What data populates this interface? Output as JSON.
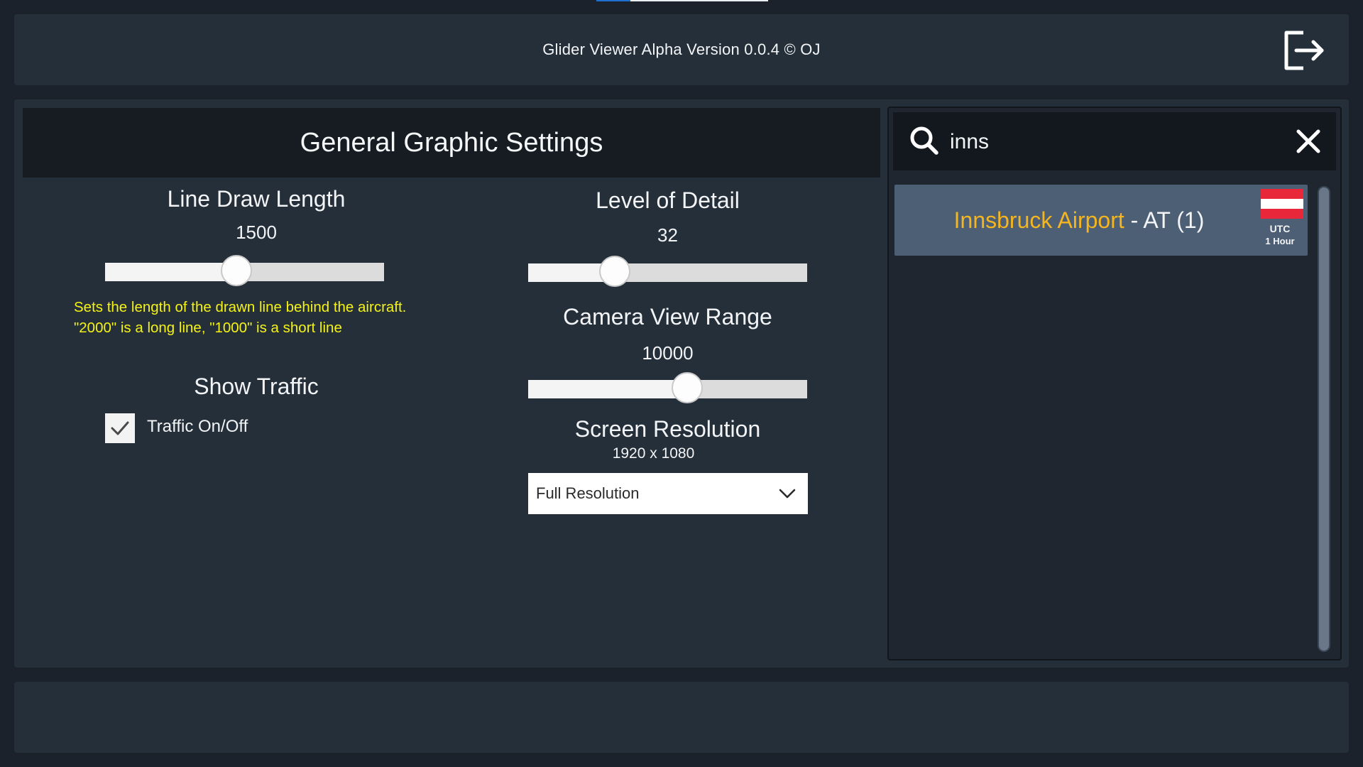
{
  "header": {
    "title": "Glider Viewer Alpha Version 0.0.4 © OJ",
    "exit_icon": "exit-door-icon"
  },
  "settings": {
    "title": "General Graphic Settings",
    "line_draw_length": {
      "label": "Line Draw Length",
      "value": "1500",
      "slider_fraction": 0.47,
      "hint": "Sets the length of the drawn line behind the aircraft. \"2000\" is a long line, \"1000\" is a short line"
    },
    "show_traffic": {
      "label": "Show Traffic",
      "checkbox_label": "Traffic On/Off",
      "checked": true
    },
    "level_of_detail": {
      "label": "Level of Detail",
      "value": "32",
      "slider_fraction": 0.31
    },
    "camera_view_range": {
      "label": "Camera View Range",
      "value": "10000",
      "slider_fraction": 0.57
    },
    "screen_resolution": {
      "label": "Screen Resolution",
      "value": "1920 x 1080",
      "dropdown_selected": "Full Resolution"
    }
  },
  "search": {
    "query": "inns",
    "results": [
      {
        "name": "Innsbruck Airport",
        "separator": " - ",
        "country_and_count": "AT (1)",
        "flag_colors": [
          "#e8283a",
          "#ffffff",
          "#e8283a"
        ],
        "utc_label": "UTC",
        "utc_offset": "1 Hour"
      }
    ]
  }
}
